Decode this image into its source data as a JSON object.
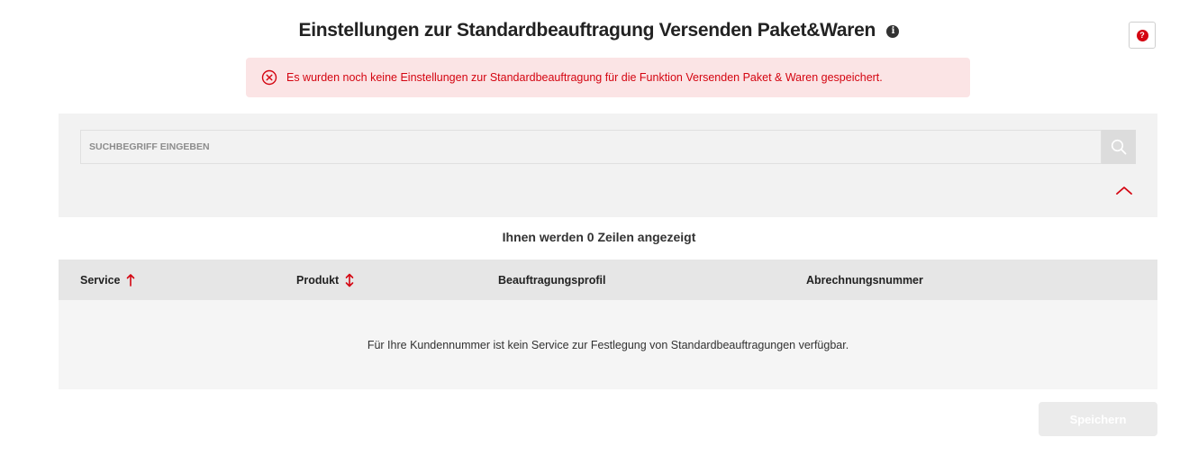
{
  "page": {
    "title": "Einstellungen zur Standardbeauftragung Versenden Paket&Waren",
    "info_icon": "info-icon",
    "help_icon": "question-icon",
    "help_label": "?"
  },
  "alert": {
    "icon": "error-circle-x-icon",
    "text": "Es wurden noch keine Einstellungen zur Standardbeauftragung für die Funktion Versenden Paket & Waren gespeichert.",
    "color": "#d40511",
    "background": "#fbe4e5"
  },
  "search": {
    "placeholder": "SUCHBEGRIFF EINGEBEN",
    "value": "",
    "icon": "search-icon",
    "collapse_icon": "chevron-up-icon"
  },
  "results": {
    "count_text": "Ihnen werden 0 Zeilen angezeigt"
  },
  "table": {
    "columns": [
      {
        "label": "Service",
        "sort_icon": "sort-ascending-icon"
      },
      {
        "label": "Produkt",
        "sort_icon": "sort-both-icon"
      },
      {
        "label": "Beauftragungsprofil"
      },
      {
        "label": "Abrechnungsnummer"
      }
    ],
    "empty_text": "Für Ihre Kundennummer ist kein Service zur Festlegung von Standardbeauftragungen verfügbar."
  },
  "actions": {
    "save_label": "Speichern",
    "save_disabled": true
  },
  "colors": {
    "accent": "#d40511",
    "panel": "#f2f2f2",
    "table_header": "#e6e6e6"
  }
}
